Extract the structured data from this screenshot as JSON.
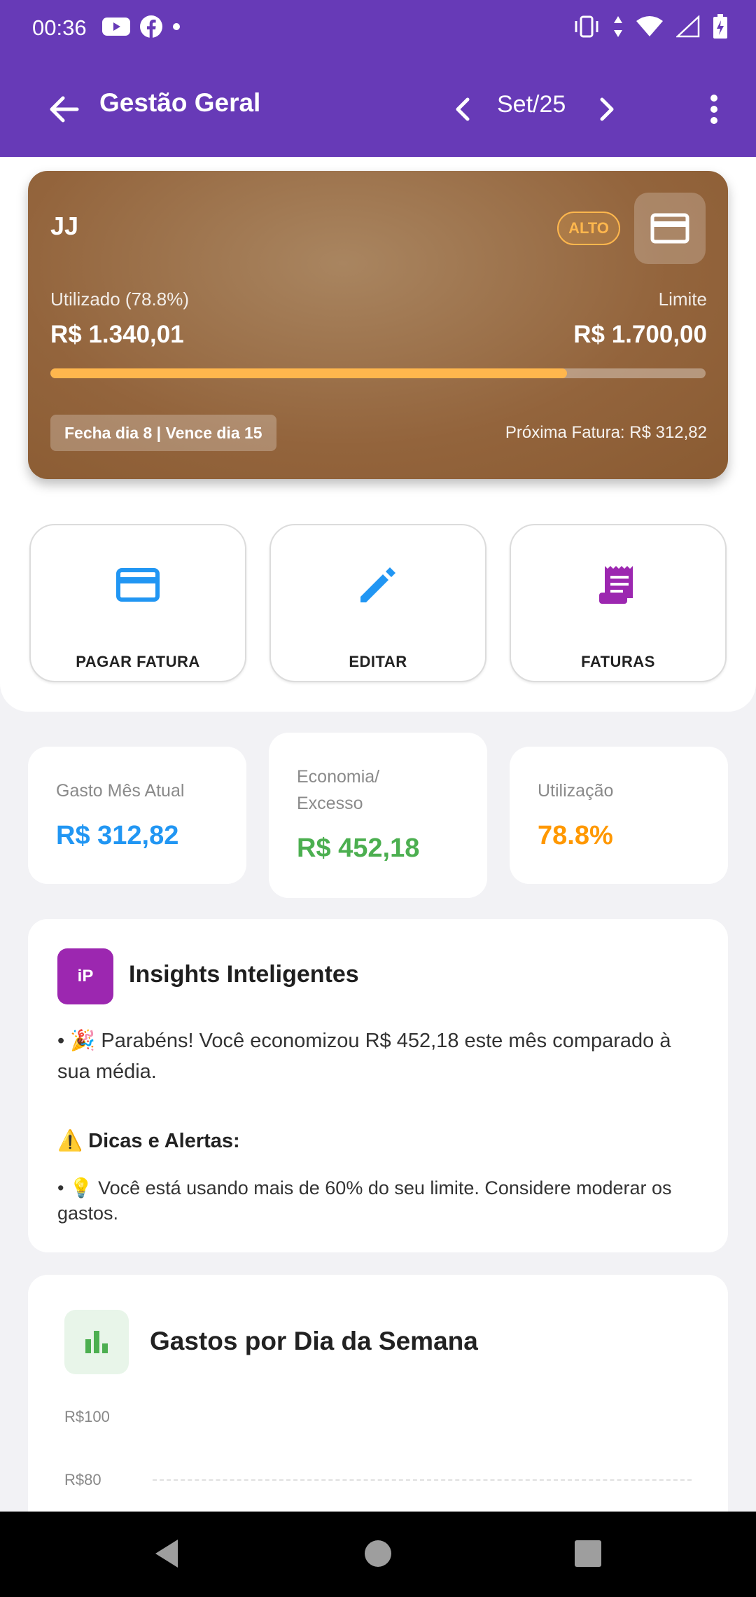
{
  "status_bar": {
    "time": "00:36"
  },
  "app_bar": {
    "title": "Gestão Geral",
    "month": "Set/25"
  },
  "card": {
    "name": "JJ",
    "badge": "ALTO",
    "used_label": "Utilizado (78.8%)",
    "used_value": "R$ 1.340,01",
    "limit_label": "Limite",
    "limit_value": "R$ 1.700,00",
    "usage_fraction": 0.788,
    "closing": "Fecha dia 8 | Vence dia 15",
    "next_invoice": "Próxima Fatura: R$ 312,82"
  },
  "actions": [
    {
      "label": "PAGAR FATURA",
      "icon": "credit-card-icon",
      "color": "#2196f3"
    },
    {
      "label": "EDITAR",
      "icon": "pencil-icon",
      "color": "#2196f3"
    },
    {
      "label": "FATURAS",
      "icon": "receipt-icon",
      "color": "#9c27b0"
    }
  ],
  "stats": [
    {
      "label": "Gasto Mês Atual",
      "value": "R$ 312,82",
      "color": "#2196f3"
    },
    {
      "label": "Economia/\nExcesso",
      "value": "R$ 452,18",
      "color": "#4caf50"
    },
    {
      "label": "Utilização",
      "value": "78.8%",
      "color": "#ff9800"
    }
  ],
  "insights": {
    "avatar": "iP",
    "title": "Insights Inteligentes",
    "line1": "• 🎉 Parabéns! Você economizou R$ 452,18 este mês comparado à sua média.",
    "tips_title": "⚠️ Dicas e Alertas:",
    "line2": "• 💡 Você está usando mais de 60% do seu limite. Considere moderar os gastos."
  },
  "chart": {
    "title": "Gastos por Dia da Semana",
    "y_ticks": [
      "R$100",
      "R$80"
    ]
  },
  "colors": {
    "primary": "#673ab7",
    "alert": "#ffb74d"
  }
}
